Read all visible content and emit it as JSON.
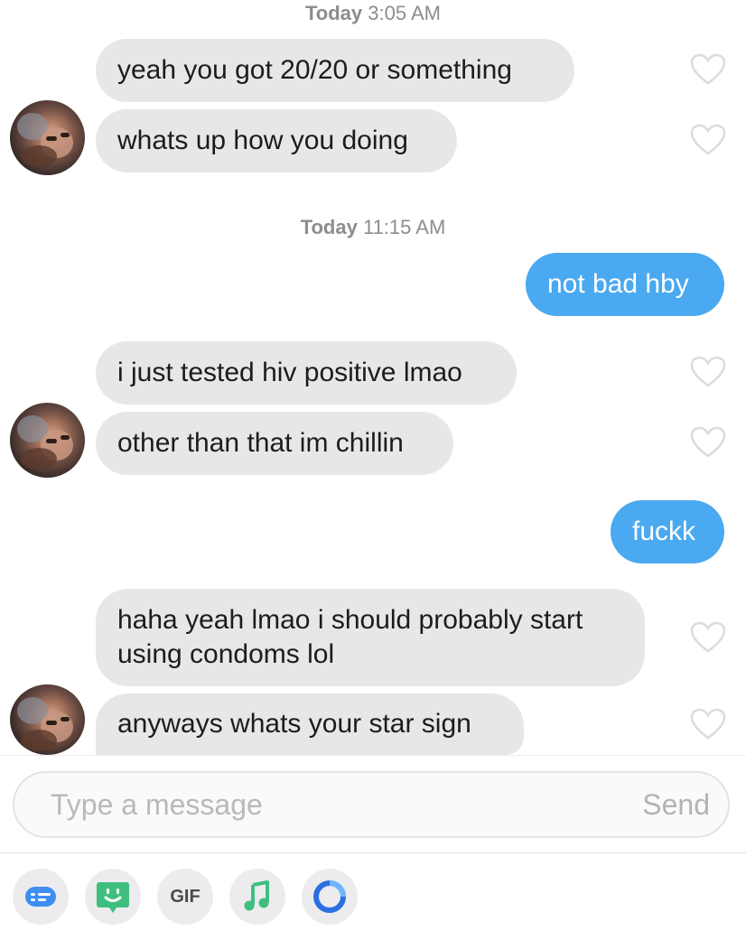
{
  "conversation": {
    "timestamps": [
      {
        "day": "Today",
        "time": "3:05 AM"
      },
      {
        "day": "Today",
        "time": "11:15 AM"
      }
    ],
    "messages": [
      {
        "from": "them",
        "text": "yeah you got 20/20 or something"
      },
      {
        "from": "them",
        "text": "whats up how you doing"
      },
      {
        "from": "me",
        "text": "not bad hby"
      },
      {
        "from": "them",
        "text": "i just tested hiv positive lmao"
      },
      {
        "from": "them",
        "text": "other than that im chillin"
      },
      {
        "from": "me",
        "text": "fuckk"
      },
      {
        "from": "them",
        "text": "haha yeah lmao i should probably start using condoms lol"
      },
      {
        "from": "them",
        "text": "anyways whats your star sign"
      }
    ]
  },
  "composer": {
    "placeholder": "Type a message",
    "send_label": "Send"
  },
  "toolbar": {
    "items": [
      {
        "icon": "sticker-chat-icon",
        "color": "#3d8ef0"
      },
      {
        "icon": "bitmoji-icon",
        "color": "#3fbf7f"
      },
      {
        "icon": "gif-icon",
        "label": "GIF"
      },
      {
        "icon": "music-note-icon",
        "color": "#3fbf7f"
      },
      {
        "icon": "circle-loop-icon",
        "color": "#2b6fe0"
      }
    ]
  },
  "colors": {
    "incoming_bubble": "#e7e7e7",
    "outgoing_bubble": "#4aa9f0",
    "timestamp_text": "#8d8d8d"
  }
}
